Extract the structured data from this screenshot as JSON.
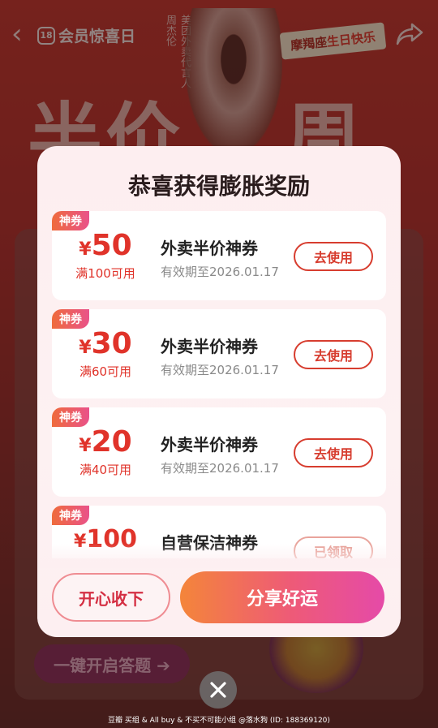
{
  "background": {
    "logo_badge": "18",
    "logo_text": "会员惊喜日",
    "celebrity_name": "周杰伦",
    "celebrity_role": "美团外卖代言人",
    "birthday_tag_prefix": "摩羯座",
    "birthday_tag_text": "生日快乐",
    "headline_left": "半价",
    "headline_right": "周末",
    "quiz_button": "一键开启答题 ➔"
  },
  "modal": {
    "title": "恭喜获得膨胀奖励",
    "coupons": [
      {
        "tag": "神券",
        "currency": "¥",
        "amount": "50",
        "condition": "满100可用",
        "name": "外卖半价神券",
        "validity": "有效期至2026.01.17",
        "action": "去使用"
      },
      {
        "tag": "神券",
        "currency": "¥",
        "amount": "30",
        "condition": "满60可用",
        "name": "外卖半价神券",
        "validity": "有效期至2026.01.17",
        "action": "去使用"
      },
      {
        "tag": "神券",
        "currency": "¥",
        "amount": "20",
        "condition": "满40可用",
        "name": "外卖半价神券",
        "validity": "有效期至2026.01.17",
        "action": "去使用"
      },
      {
        "tag": "神券",
        "currency": "¥",
        "amount": "100",
        "condition": "",
        "name": "自营保洁神券",
        "validity": "",
        "action": "已领取"
      }
    ],
    "accept_button": "开心收下",
    "share_button": "分享好运"
  },
  "footer": {
    "text": "豆瓣  买组 & All buy & 不买不可能小组 @落水狗 (ID: 188369120)"
  },
  "colors": {
    "accent_red": "#e0332a",
    "share_gradient_start": "#f4853a",
    "share_gradient_end": "#e54aa8"
  }
}
